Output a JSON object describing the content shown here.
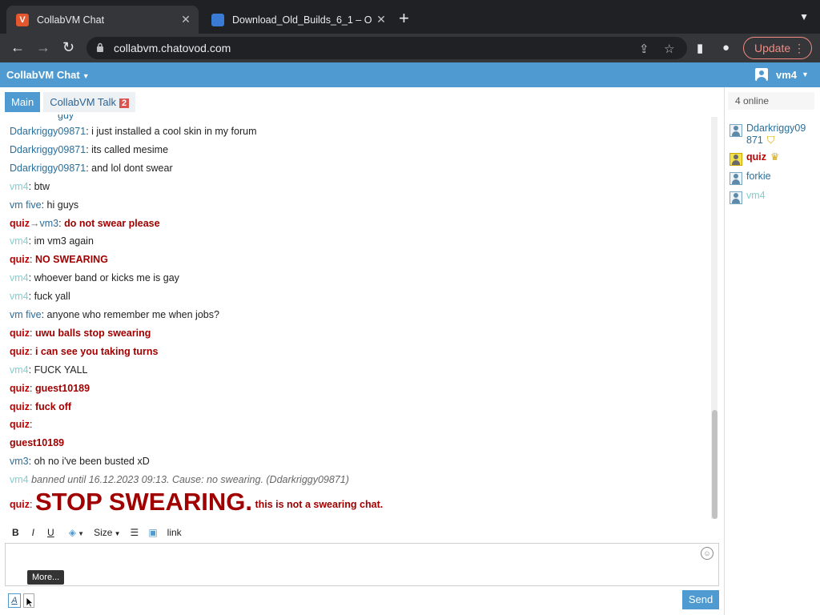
{
  "browser": {
    "tabs": [
      {
        "title": "CollabVM Chat",
        "favicon": "V"
      },
      {
        "title": "Download_Old_Builds_6_1 – O"
      }
    ],
    "url": "collabvm.chatovod.com",
    "update_label": "Update"
  },
  "header": {
    "brand": "CollabVM Chat",
    "username": "vm4",
    "accent_color": "#4f9ad0"
  },
  "chat_tabs": [
    {
      "label": "Main",
      "selected": true
    },
    {
      "label": "CollabVM Talk",
      "badge": "2",
      "selected": false
    }
  ],
  "messages": [
    {
      "nick": "Ddarkriggy09871",
      "nick_style": "blue",
      "sep": ": ",
      "text": "i just installed a cool skin in my forum",
      "text_style": "normal"
    },
    {
      "nick": "Ddarkriggy09871",
      "nick_style": "blue",
      "sep": ": ",
      "text": "its called mesime",
      "text_style": "normal"
    },
    {
      "nick": "Ddarkriggy09871",
      "nick_style": "blue",
      "sep": ": ",
      "text": "and lol dont swear",
      "text_style": "normal"
    },
    {
      "nick": "vm4",
      "nick_style": "faded",
      "sep": ": ",
      "text": "btw",
      "text_style": "normal"
    },
    {
      "nick": "vm five",
      "nick_style": "blue",
      "sep": ": ",
      "text": "hi guys",
      "text_style": "normal"
    },
    {
      "nick": "quiz",
      "nick_style": "red",
      "arrow": "→",
      "target": "vm3",
      "sep": ": ",
      "text": "do not swear please",
      "text_style": "red"
    },
    {
      "nick": "vm4",
      "nick_style": "faded",
      "sep": ": ",
      "text": "im vm3 again",
      "text_style": "normal"
    },
    {
      "nick": "quiz",
      "nick_style": "red",
      "sep": ": ",
      "text": "NO SWEARING",
      "text_style": "red"
    },
    {
      "nick": "vm4",
      "nick_style": "faded",
      "sep": ": ",
      "text": "whoever band or kicks me is gay",
      "text_style": "normal"
    },
    {
      "nick": "vm4",
      "nick_style": "faded",
      "sep": ": ",
      "text": "fuck yall",
      "text_style": "normal"
    },
    {
      "nick": "vm five",
      "nick_style": "blue",
      "sep": ": ",
      "text": "anyone who remember me when jobs?",
      "text_style": "normal"
    },
    {
      "nick": "quiz",
      "nick_style": "red",
      "sep": ": ",
      "text": "uwu balls stop swearing",
      "text_style": "red"
    },
    {
      "nick": "quiz",
      "nick_style": "red",
      "sep": ": ",
      "text": "i can see you taking turns",
      "text_style": "red"
    },
    {
      "nick": "vm4",
      "nick_style": "faded",
      "sep": ": ",
      "text": "FUCK YALL",
      "text_style": "normal"
    },
    {
      "nick": "quiz",
      "nick_style": "red",
      "sep": ": ",
      "text": "guest10189",
      "text_style": "red"
    },
    {
      "nick": "quiz",
      "nick_style": "red",
      "sep": ": ",
      "text": "fuck off",
      "text_style": "red"
    },
    {
      "nick": "quiz",
      "nick_style": "red",
      "sep": ":",
      "text": "",
      "text_style": "red"
    },
    {
      "nick": "",
      "nick_style": "red",
      "sep": "",
      "text": "guest10189",
      "text_style": "red"
    },
    {
      "nick": "vm3",
      "nick_style": "blue",
      "sep": ": ",
      "text": "oh no i've been busted xD",
      "text_style": "normal"
    },
    {
      "nick": "vm4",
      "nick_style": "faded",
      "sep": " ",
      "text": "banned until 16.12.2023 09:13. Cause: no swearing. (Ddarkriggy09871)",
      "text_style": "sys"
    }
  ],
  "last_message": {
    "nick": "quiz",
    "sep": ": ",
    "big_text": "STOP SWEARING.",
    "text": " this is not a swearing chat."
  },
  "editor": {
    "bold": "B",
    "italic": "I",
    "underline": "U",
    "size_label": "Size",
    "link_label": "link",
    "tooltip": "More...",
    "format_button": "A",
    "send_label": "Send"
  },
  "sidebar": {
    "online_label": "4 online",
    "users": [
      {
        "name": "Ddarkriggy09\n871",
        "style": "blue",
        "icon": "user-icon",
        "badge": "shield-icon"
      },
      {
        "name": "quiz",
        "style": "red",
        "icon": "user-gold-icon",
        "badge": "crown-icon"
      },
      {
        "name": "forkie",
        "style": "blue",
        "icon": "user-icon"
      },
      {
        "name": "vm4",
        "style": "faded",
        "icon": "user-icon"
      }
    ]
  }
}
